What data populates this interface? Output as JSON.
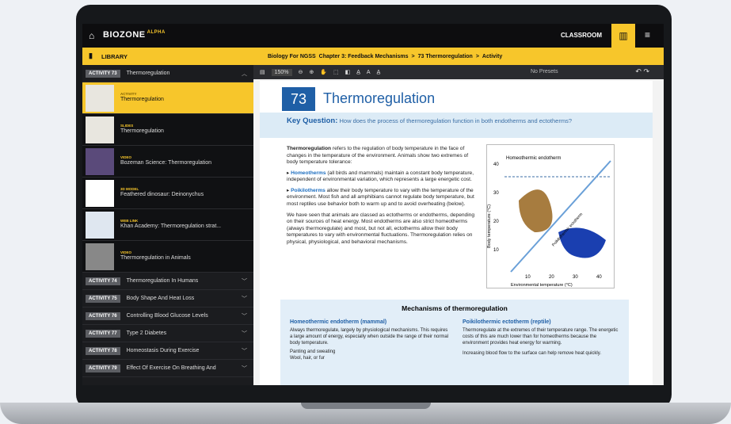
{
  "app": {
    "logo": "BIOZONE",
    "logo_tag": "ALPHA",
    "classroom": "CLASSROOM"
  },
  "sidebar": {
    "library": "LIBRARY",
    "current": {
      "badge": "ACTIVITY 73",
      "label": "Thermoregulation"
    },
    "items": [
      {
        "type": "ACTIVITY",
        "label": "Thermoregulation"
      },
      {
        "type": "SLIDES",
        "label": "Thermoregulation"
      },
      {
        "type": "VIDEO",
        "label": "Bozeman Science: Thermoregulation"
      },
      {
        "type": "3D MODEL",
        "label": "Feathered dinosaur: Deinonychus"
      },
      {
        "type": "WEB LINK",
        "label": "Khan Academy: Thermoregulation strat..."
      },
      {
        "type": "VIDEO",
        "label": "Thermoregulation in Animals"
      }
    ],
    "activities": [
      {
        "badge": "ACTIVITY 74",
        "label": "Thermoregulation In Humans"
      },
      {
        "badge": "ACTIVITY 75",
        "label": "Body Shape And Heat Loss"
      },
      {
        "badge": "ACTIVITY 76",
        "label": "Controlling Blood Glucose Levels"
      },
      {
        "badge": "ACTIVITY 77",
        "label": "Type 2 Diabetes"
      },
      {
        "badge": "ACTIVITY 78",
        "label": "Homeostasis During Exercise"
      },
      {
        "badge": "ACTIVITY 79",
        "label": "Effect Of Exercise On Breathing And"
      }
    ]
  },
  "breadcrumb": [
    "Biology For NGSS",
    "Chapter 3: Feedback Mechanisms",
    ">",
    "73 Thermoregulation",
    ">",
    "Activity"
  ],
  "toolbar": {
    "zoom": "150%",
    "presets": "No Presets"
  },
  "page": {
    "number": "73",
    "title": "Thermoregulation",
    "kq_label": "Key Question:",
    "kq": "How does the process of thermoregulation function in both endotherms and ectotherms?",
    "p1a": "Thermoregulation",
    "p1b": " refers to the regulation of body temperature in the face of changes in the temperature of the environment. Animals show two extremes of body temperature tolerance:",
    "b1a": "Homeotherms",
    "b1b": " (all birds and mammals) maintain a constant body temperature, independent of environmental variation, which represents a large energetic cost.",
    "b2a": "Poikilotherms",
    "b2b": " allow their body temperature to vary with the temperature of the environment. Most fish and all amphibians cannot regulate body temperature, but most reptiles use behavior both to warm up and to avoid overheating (below).",
    "p2": "We have seen that animals are classed as ectotherms or endotherms, depending on their sources of heat energy. Most endotherms are also strict homeotherms (always thermoregulate) and most, but not all, ectotherms allow their body temperatures to vary with environmental fluctuations. Thermoregulation relies on physical, physiological, and behavioral mechanisms.",
    "graph": {
      "title": "Homeothermic endotherm",
      "ylabel": "Body temperature (°C)",
      "xlabel": "Environmental temperature (°C)",
      "line_label": "Poikilothermic ectotherm",
      "yticks": [
        "40",
        "30",
        "20",
        "10"
      ],
      "xticks": [
        "10",
        "20",
        "30",
        "40"
      ]
    },
    "mech_title": "Mechanisms of thermoregulation",
    "c1h": "Homeothermic endotherm (mammal)",
    "c1": "Always thermoregulate, largely by physiological mechanisms. This requires a large amount of energy, especially when outside the range of their normal body temperature.",
    "c1b": "Panting and sweating",
    "c1c": "Wool, hair, or fur",
    "c2h": "Poikilothermic ectotherm (reptile)",
    "c2": "Thermoregulate at the extremes of their temperature range. The energetic costs of this are much lower than for homeotherms because the environment provides heat energy for warming.",
    "c2b": "Increasing blood flow to the surface can help remove heat quickly."
  }
}
